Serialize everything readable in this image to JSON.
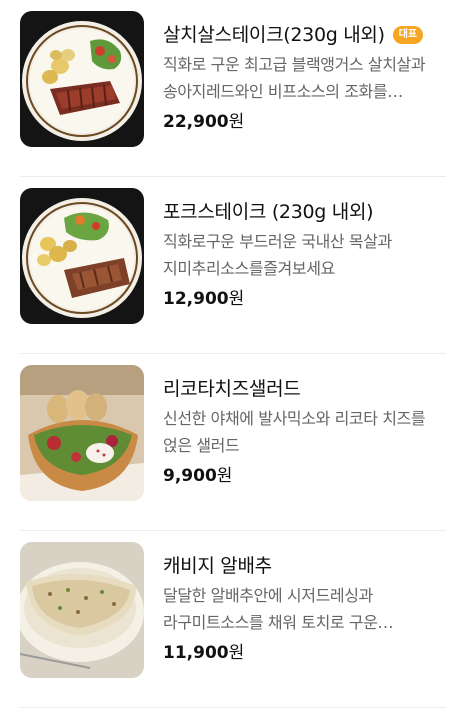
{
  "menu": {
    "items": [
      {
        "name": "살치살스테이크(230g 내외)",
        "badge": "대표",
        "description": "직화로 구운 최고급 블랙앵거스 살치살과 송아지레드와인 비프소스의 조화를 느껴보세요",
        "price": "22,900",
        "currency": "원",
        "image": "steak-plate-photo"
      },
      {
        "name": "포크스테이크 (230g 내외)",
        "badge": "",
        "description": "직화로구운 부드러운 국내산 목살과 지미추리소스를즐겨보세요",
        "price": "12,900",
        "currency": "원",
        "image": "pork-steak-plate-photo"
      },
      {
        "name": "리코타치즈샐러드",
        "badge": "",
        "description": "신선한 야채에 발사믹소와 리코타 치즈를 얹은 샐러드",
        "price": "9,900",
        "currency": "원",
        "image": "ricotta-salad-photo"
      },
      {
        "name": "캐비지 알배추",
        "badge": "",
        "description": "달달한 알배추안에 시저드레싱과 라구미트소스를 채워 토치로 구운 알배추샐러드",
        "price": "11,900",
        "currency": "원",
        "image": "cabbage-dish-photo"
      }
    ]
  },
  "colors": {
    "badge": "#f5a623",
    "description": "#666666",
    "text": "#111111",
    "divider": "#ececec"
  }
}
